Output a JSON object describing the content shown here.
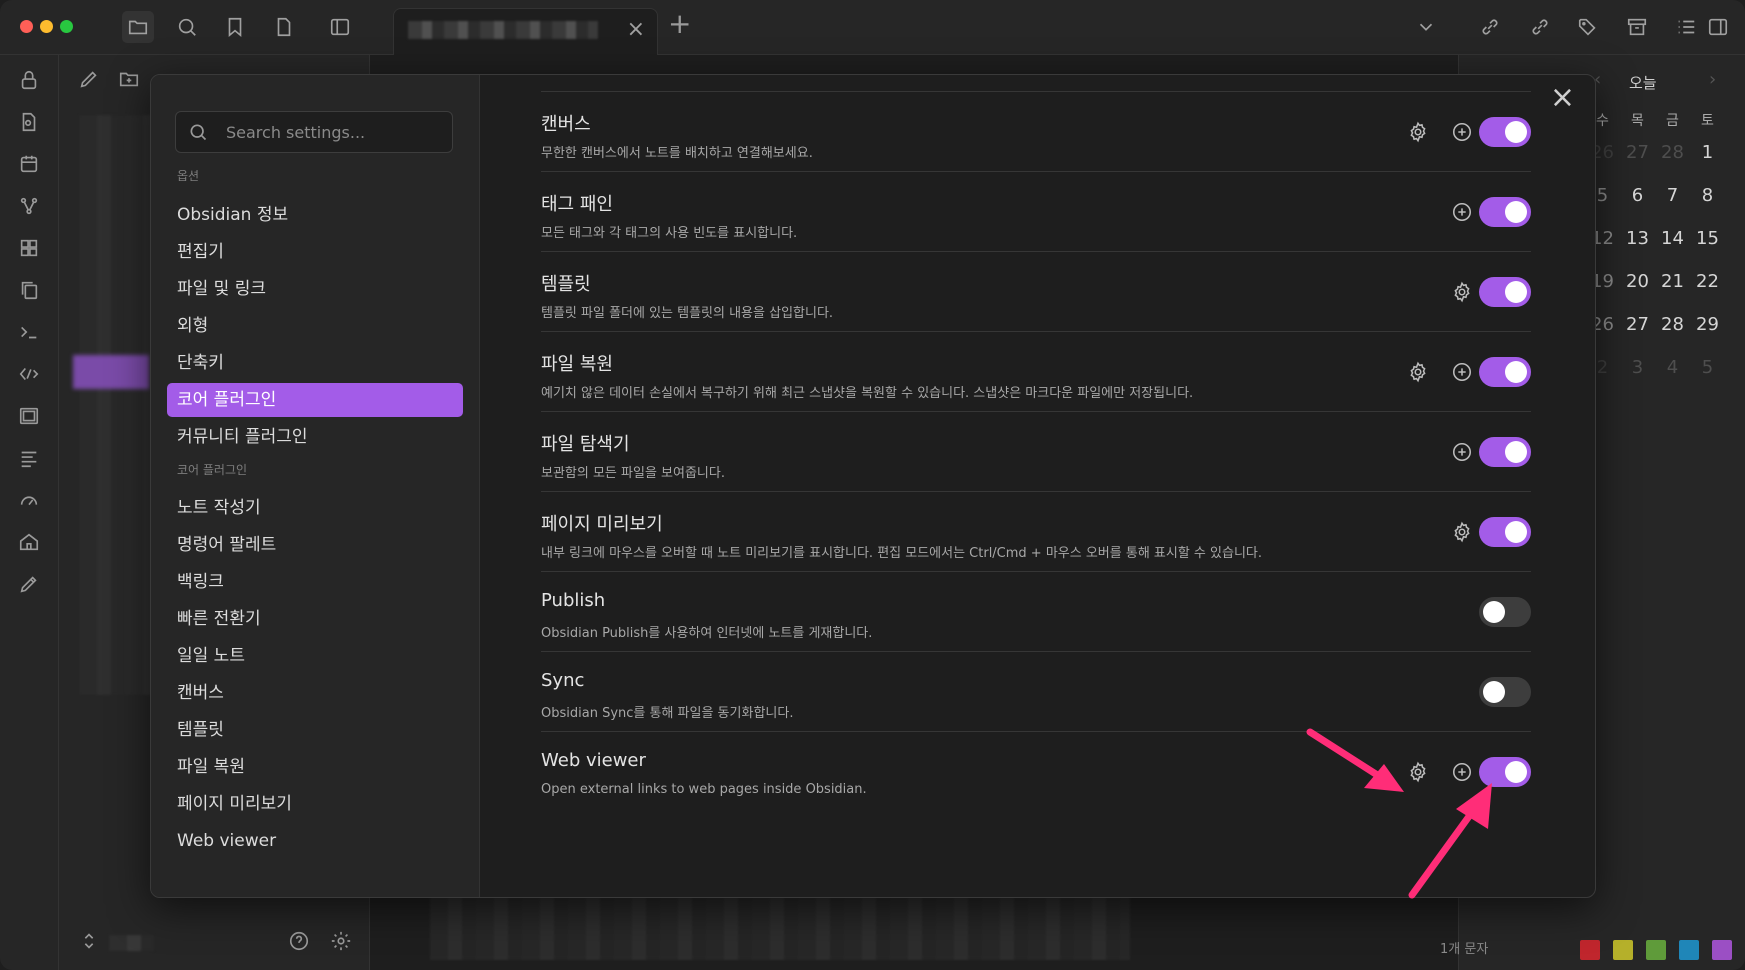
{
  "settings_search": {
    "placeholder": "Search settings..."
  },
  "sidebar": {
    "section_options": "옵션",
    "options": [
      {
        "label": "Obsidian 정보"
      },
      {
        "label": "편집기"
      },
      {
        "label": "파일 및 링크"
      },
      {
        "label": "외형"
      },
      {
        "label": "단축키"
      },
      {
        "label": "코어 플러그인",
        "active": true
      },
      {
        "label": "커뮤니티 플러그인"
      }
    ],
    "section_core": "코어 플러그인",
    "core": [
      {
        "label": "노트 작성기"
      },
      {
        "label": "명령어 팔레트"
      },
      {
        "label": "백링크"
      },
      {
        "label": "빠른 전환기"
      },
      {
        "label": "일일 노트"
      },
      {
        "label": "캔버스"
      },
      {
        "label": "템플릿"
      },
      {
        "label": "파일 복원"
      },
      {
        "label": "페이지 미리보기"
      },
      {
        "label": "Web viewer"
      }
    ]
  },
  "plugins": [
    {
      "name": "캔버스",
      "desc": "무한한 캔버스에서 노트를 배치하고 연결해보세요.",
      "gear": true,
      "add": true,
      "enabled": true
    },
    {
      "name": "태그 패인",
      "desc": "모든 태그와 각 태그의 사용 빈도를 표시합니다.",
      "gear": false,
      "add": true,
      "enabled": true
    },
    {
      "name": "템플릿",
      "desc": "템플릿 파일 폴더에 있는 템플릿의 내용을 삽입합니다.",
      "gear": true,
      "add": false,
      "enabled": true
    },
    {
      "name": "파일 복원",
      "desc": "예기치 않은 데이터 손실에서 복구하기 위해 최근 스냅샷을 복원할 수 있습니다. 스냅샷은 마크다운 파일에만 저장됩니다.",
      "gear": true,
      "add": true,
      "enabled": true
    },
    {
      "name": "파일 탐색기",
      "desc": "보관함의 모든 파일을 보여줍니다.",
      "gear": false,
      "add": true,
      "enabled": true
    },
    {
      "name": "페이지 미리보기",
      "desc": "내부 링크에 마우스를 오버할 때 노트 미리보기를 표시합니다. 편집 모드에서는 Ctrl/Cmd + 마우스 오버를 통해 표시할 수 있습니다.",
      "gear": true,
      "add": false,
      "enabled": true
    },
    {
      "name": "Publish",
      "desc": "Obsidian Publish를 사용하여 인터넷에 노트를 게재합니다.",
      "gear": false,
      "add": false,
      "enabled": false
    },
    {
      "name": "Sync",
      "desc": "Obsidian Sync를 통해 파일을 동기화합니다.",
      "gear": false,
      "add": false,
      "enabled": false
    },
    {
      "name": "Web viewer",
      "desc": "Open external links to web pages inside Obsidian.",
      "gear": true,
      "add": true,
      "enabled": true
    }
  ],
  "calendar": {
    "today_label": "오늘",
    "weekdays": [
      "수",
      "목",
      "금",
      "토"
    ],
    "weeks": [
      [
        "26",
        "27",
        "28",
        "1"
      ],
      [
        "5",
        "6",
        "7",
        "8"
      ],
      [
        "12",
        "13",
        "14",
        "15"
      ],
      [
        "19",
        "20",
        "21",
        "22"
      ],
      [
        "26",
        "27",
        "28",
        "29"
      ],
      [
        "2",
        "3",
        "4",
        "5"
      ]
    ]
  },
  "status_bar": {
    "chars": "1개 문자"
  },
  "colors": {
    "accent": "#a35ce8",
    "annotation_arrow": "#ff2d78",
    "swatches": [
      "#c0262d",
      "#b5b02a",
      "#5f9b3a",
      "#1f86b8",
      "#9b4fc4"
    ]
  },
  "icons": [
    "folder-icon",
    "search-icon",
    "bookmark-icon",
    "file-icon",
    "sidebar-toggle-icon",
    "gear-icon",
    "plus-circle-icon",
    "close-icon"
  ]
}
